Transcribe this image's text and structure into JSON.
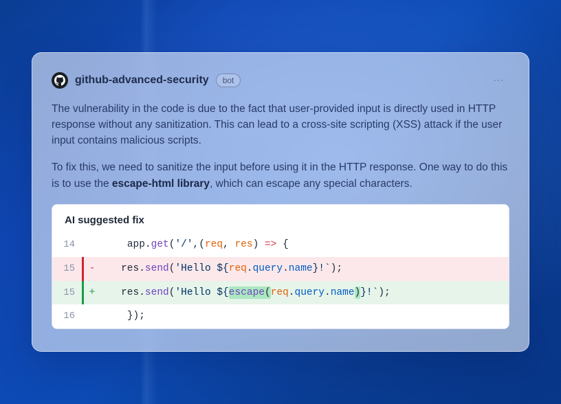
{
  "author": {
    "name": "github-advanced-security",
    "badge": "bot"
  },
  "body": {
    "paragraph1": "The vulnerability in the code is due to the fact that user-provided input is directly used in HTTP response without any sanitization. This can lead to a cross-site scripting (XSS) attack if the user input contains malicious scripts.",
    "paragraph2_prefix": "To fix this, we need to sanitize the input before using it in the HTTP response. One way to do this is to use the ",
    "paragraph2_bold": "escape-html library",
    "paragraph2_suffix": ", which can escape any special characters."
  },
  "panel": {
    "title": "AI suggested fix"
  },
  "code": {
    "lines": [
      {
        "no": "14",
        "type": "plain",
        "marker": "",
        "html": "    <span class='tok-obj'>app</span><span class='tok-punct'>.</span><span class='tok-method'>get</span><span class='tok-punct'>(</span><span class='tok-str'>'/'</span><span class='tok-punct'>,(</span><span class='tok-param'>req</span><span class='tok-punct'>, </span><span class='tok-param'>res</span><span class='tok-punct'>) </span><span class='tok-arrow'>=&gt;</span><span class='tok-punct'> {</span>"
      },
      {
        "no": "15",
        "type": "removed",
        "marker": "-",
        "html": "   <span class='tok-obj'>res</span><span class='tok-punct'>.</span><span class='tok-method'>send</span><span class='tok-punct'>(</span><span class='tok-str'>'Hello ${</span><span class='tok-param'>req</span><span class='tok-punct'>.</span><span class='tok-prop'>query</span><span class='tok-punct'>.</span><span class='tok-prop'>name</span><span class='tok-str'>}!`</span><span class='tok-punct'>);</span>"
      },
      {
        "no": "15",
        "type": "added",
        "marker": "+",
        "html": "   <span class='tok-obj'>res</span><span class='tok-punct'>.</span><span class='tok-method'>send</span><span class='tok-punct'>(</span><span class='tok-str'>'Hello ${</span><span class='hl'><span class='tok-method'>escape</span><span class='tok-punct'>(</span></span><span class='tok-param'>req</span><span class='tok-punct'>.</span><span class='tok-prop'>query</span><span class='tok-punct'>.</span><span class='tok-prop'>name</span><span class='hl'><span class='tok-punct'>)</span></span><span class='tok-str'>}!`</span><span class='tok-punct'>);</span>"
      },
      {
        "no": "16",
        "type": "plain",
        "marker": "",
        "html": "    <span class='tok-punct'>});</span>"
      }
    ]
  }
}
